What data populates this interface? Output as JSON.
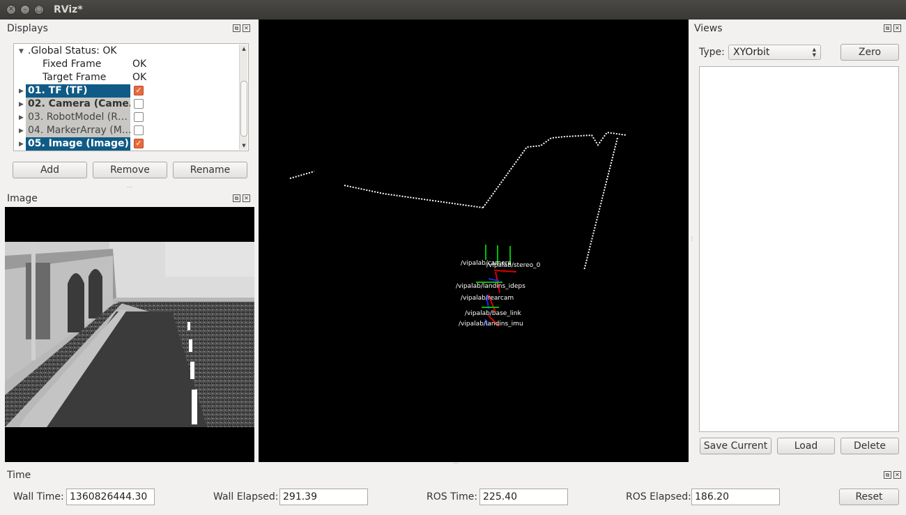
{
  "window": {
    "title": "RViz*"
  },
  "displays": {
    "title": "Displays",
    "global_status": ".Global Status: OK",
    "fixed_frame": {
      "label": "Fixed Frame",
      "value": "OK"
    },
    "target_frame": {
      "label": "Target Frame",
      "value": "OK"
    },
    "items": [
      {
        "label": "01. TF (TF)",
        "checked": true
      },
      {
        "label": "02. Camera (Came…",
        "checked": false
      },
      {
        "label": "03. RobotModel (R…",
        "checked": false
      },
      {
        "label": "04. MarkerArray (M…",
        "checked": false
      },
      {
        "label": "05. Image (Image)",
        "checked": true
      }
    ],
    "buttons": {
      "add": "Add",
      "remove": "Remove",
      "rename": "Rename"
    }
  },
  "image_panel": {
    "title": "Image"
  },
  "views": {
    "title": "Views",
    "type_label": "Type:",
    "type_value": "XYOrbit",
    "zero": "Zero",
    "buttons": {
      "save_current": "Save Current",
      "load": "Load",
      "delete": "Delete"
    }
  },
  "tf_frames": [
    "/vipalab/camera",
    "/vipalab/stereo_0",
    "/vipalab/landins_ideps",
    "/vipalab/rearcam",
    "/vipalab/base_link",
    "/vipalab/landins_imu"
  ],
  "time": {
    "title": "Time",
    "wall_time_label": "Wall Time:",
    "wall_time": "1360826444.30",
    "wall_elapsed_label": "Wall Elapsed:",
    "wall_elapsed": "291.39",
    "ros_time_label": "ROS Time:",
    "ros_time": "225.40",
    "ros_elapsed_label": "ROS Elapsed:",
    "ros_elapsed": "186.20",
    "reset": "Reset"
  },
  "colors": {
    "selection": "#0f5b86",
    "checkbox": "#e9693e"
  }
}
